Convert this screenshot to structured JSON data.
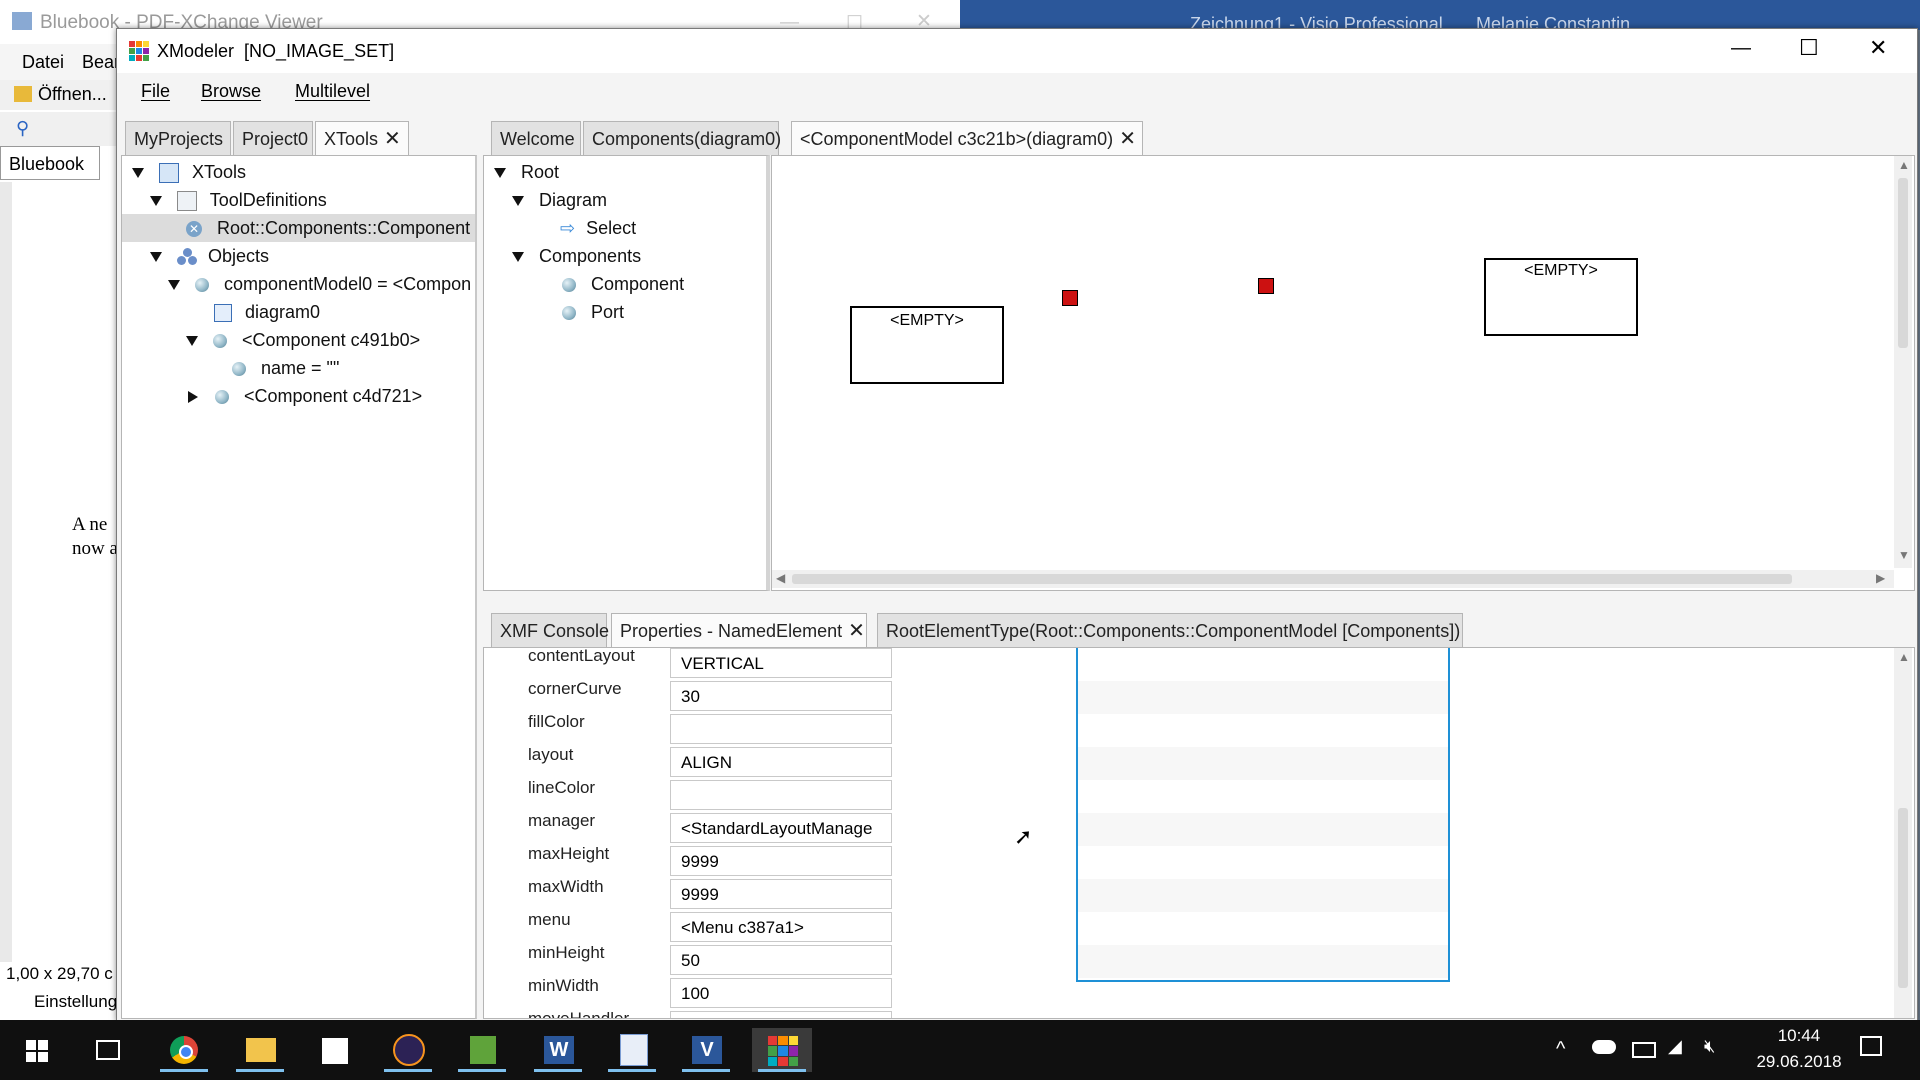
{
  "bg_pdf": {
    "title": "Bluebook - PDF-XChange Viewer",
    "menu": [
      "Datei",
      "Bear"
    ],
    "open_label": "Öffnen...",
    "doc_tab": "Bluebook",
    "text1": "A ne",
    "text2": "now a",
    "size_status": "1,00 x 29,70 c",
    "settings": "Einstellung"
  },
  "bg_visio": {
    "title": "Zeichnung1 - Visio Professional",
    "user": "Melanie Constantin"
  },
  "window": {
    "title": "XModeler  [NO_IMAGE_SET]",
    "menu": [
      "File",
      "Browse",
      "Multilevel"
    ]
  },
  "left_tabs": [
    {
      "label": "MyProjects"
    },
    {
      "label": "Project0"
    },
    {
      "label": "XTools",
      "closable": true,
      "active": true
    }
  ],
  "left_tree": [
    {
      "label": "XTools",
      "icon": "xtools-icon",
      "expanded": true
    },
    {
      "label": "ToolDefinitions",
      "icon": "tooldefinitions-icon",
      "expanded": true
    },
    {
      "label": "Root::Components::Component",
      "icon": "tool-icon",
      "selected": true
    },
    {
      "label": "Objects",
      "icon": "objects-icon",
      "expanded": true
    },
    {
      "label": "componentModel0 = <Compon",
      "icon": "object-ball-icon",
      "expanded": true
    },
    {
      "label": "diagram0",
      "icon": "diagram-icon"
    },
    {
      "label": "<Component c491b0>",
      "icon": "object-ball-icon",
      "expanded": true
    },
    {
      "label": "name = \"\"",
      "icon": "object-ball-icon"
    },
    {
      "label": "<Component c4d721>",
      "icon": "object-ball-icon",
      "expanded": false
    }
  ],
  "editor_tabs": [
    {
      "label": "Welcome"
    },
    {
      "label": "Components(diagram0)"
    },
    {
      "label": "<ComponentModel c3c21b>(diagram0)",
      "closable": true,
      "active": true
    }
  ],
  "palette_tree": [
    {
      "label": "Root",
      "expanded": true
    },
    {
      "label": "Diagram",
      "expanded": true
    },
    {
      "label": "Select",
      "icon": "select-arrow-icon"
    },
    {
      "label": "Components",
      "expanded": true
    },
    {
      "label": "Component",
      "icon": "object-ball-icon"
    },
    {
      "label": "Port",
      "icon": "object-ball-icon"
    }
  ],
  "diagram": {
    "box1_label": "<EMPTY>",
    "box2_label": "<EMPTY>",
    "port_color": "#cc1111"
  },
  "bottom_tabs": [
    {
      "label": "XMF Console"
    },
    {
      "label": "Properties - NamedElement",
      "closable": true,
      "active": true
    },
    {
      "label": "RootElementType(Root::Components::ComponentModel [Components])"
    }
  ],
  "properties": [
    {
      "name": "contentLayout",
      "value": "VERTICAL"
    },
    {
      "name": "cornerCurve",
      "value": "30"
    },
    {
      "name": "fillColor",
      "value": ""
    },
    {
      "name": "layout",
      "value": "ALIGN"
    },
    {
      "name": "lineColor",
      "value": ""
    },
    {
      "name": "manager",
      "value": "<StandardLayoutManage"
    },
    {
      "name": "maxHeight",
      "value": "9999"
    },
    {
      "name": "maxWidth",
      "value": "9999"
    },
    {
      "name": "menu",
      "value": "<Menu c387a1>"
    },
    {
      "name": "minHeight",
      "value": "50"
    },
    {
      "name": "minWidth",
      "value": "100"
    },
    {
      "name": "moveHandler",
      "value": ""
    }
  ],
  "taskbar": {
    "time": "10:44",
    "date": "29.06.2018",
    "apps": [
      "start-icon",
      "task-view-icon",
      "chrome-icon",
      "file-explorer-icon",
      "sticky-notes-icon",
      "eclipse-icon",
      "pdf-xchange-icon",
      "word-icon",
      "pdf-icon",
      "visio-icon",
      "xmodeler-icon"
    ]
  },
  "colors": {
    "selection_blue": "#1e90d6",
    "title_text": "#000000"
  }
}
